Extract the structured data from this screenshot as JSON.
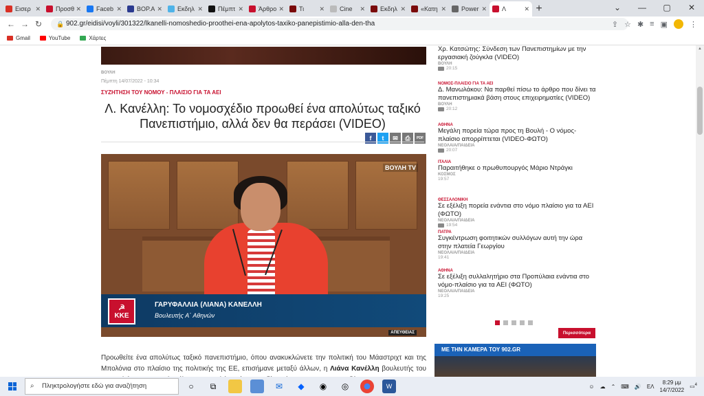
{
  "browser": {
    "tabs": [
      {
        "label": "Εισερ",
        "color": "#d93025",
        "active": false
      },
      {
        "label": "Προσθ",
        "color": "#c8102e",
        "active": false
      },
      {
        "label": "Faceb",
        "color": "#1877f2",
        "active": false
      },
      {
        "label": "BOP.A",
        "color": "#2b3a8f",
        "active": false
      },
      {
        "label": "Εκδηλ",
        "color": "#4fb3e8",
        "active": false
      },
      {
        "label": "Πέμπτ",
        "color": "#111111",
        "active": false
      },
      {
        "label": "Άρθρο",
        "color": "#c8102e",
        "active": false
      },
      {
        "label": "Τι",
        "color": "#7a0a0a",
        "active": false
      },
      {
        "label": "Cine",
        "color": "#bbbbbb",
        "active": false
      },
      {
        "label": "Εκδηλ",
        "color": "#7a0a0a",
        "active": false
      },
      {
        "label": "«Κατη",
        "color": "#7a0a0a",
        "active": false
      },
      {
        "label": "Power",
        "color": "#666666",
        "active": false
      },
      {
        "label": "Λ",
        "color": "#c8102e",
        "active": true
      }
    ],
    "new_tab": "+",
    "url": "902.gr/eidisi/voyli/301322/lkanelli-nomoshedio-proothei-ena-apolytos-taxiko-panepistimio-alla-den-tha",
    "bookmarks": [
      {
        "label": "Gmail",
        "color": "#d93025"
      },
      {
        "label": "YouTube",
        "color": "#ff0000"
      },
      {
        "label": "Χάρτες",
        "color": "#34a853"
      }
    ]
  },
  "article": {
    "source": "ΒΟΥΛΗ",
    "date": "Πέμπτη 14/07/2022 - 10:34",
    "category": "ΣΥΖΗΤΗΣΗ ΤΟΥ ΝΟΜΟΥ - ΠΛΑΙΣΙΟ ΓΙΑ ΤΑ ΑΕΙ",
    "title": "Λ. Κανέλλη: Το νομοσχέδιο προωθεί ένα απολύτως ταξικό Πανεπιστήμιο, αλλά δεν θα περάσει (VIDEO)",
    "share": {
      "facebook": "f",
      "twitter": "t",
      "email": "✉",
      "print": "⎙",
      "pdf": "PDF"
    },
    "video": {
      "channel_tag": "ΒΟΥΛΗ TV",
      "party_logo": "KKE",
      "speaker_name": "ΓΑΡΥΦΑΛΛΙΑ (ΛΙΑΝΑ) ΚΑΝΕΛΛΗ",
      "speaker_role": "Βουλευτής Α΄ Αθηνών",
      "live_tag": "ΑΠΕΥΘΕΙΑΣ"
    },
    "body_p1": "Προωθείτε ένα απολύτως ταξικό πανεπιστήμιο, όπου ανακυκλώνετε την πολιτική του Μάαστριχτ και της Μπολόνια στο πλαίσιο της πολιτικής της ΕΕ, επισήμανε μεταξύ άλλων, η ",
    "body_bold": "Λιάνα Κανέλλη",
    "body_p2": " βουλευτής του ΚΚΕ μιλώντας  στην Ολομέλεια της Βουλής επί του σχεδίου νόμου για τα ΑΕΙ, η συζήτηση του"
  },
  "sidebar": {
    "news": [
      {
        "section": "",
        "headline": "Χρ. Κατσώτης: Σύνδεση των Πανεπιστημίων με την εργασιακή ζούγκλα (VIDEO)",
        "sub": "ΒΟΥΛΗ",
        "time": "20:15",
        "media": "video"
      },
      {
        "section": "ΝΟΜΟΣ-ΠΛΑΙΣΙΟ ΓΙΑ ΤΑ ΑΕΙ",
        "headline": "Δ. Μανωλάκου: Να παρθεί πίσω το άρθρο που δίνει τα πανεπιστημιακά βάση στους επιχειρηματίες (VIDEO)",
        "sub": "ΒΟΥΛΗ",
        "time": "20:12",
        "media": "video"
      },
      {
        "section": "ΑΘΗΝΑ",
        "headline": "Μεγάλη πορεία τώρα προς τη Βουλή - Ο νόμος-πλαίσιο απορρίπτεται (VIDEO-ΦΩΤΟ)",
        "sub": "ΝΕΟΛΑΙΑ/ΠΑΙΔΕΙΑ",
        "time": "20:07",
        "media": "video"
      },
      {
        "section": "ΙΤΑΛΙΑ",
        "headline": "Παραιτήθηκε ο πρωθυπουργός Μάριο Ντράγκι",
        "sub": "ΚΟΣΜΟΣ",
        "time": "19:57",
        "media": ""
      },
      {
        "section": "ΘΕΣΣΑΛΟΝΙΚΗ",
        "headline": "Σε εξέλιξη πορεία ενάντια στο νόμο πλαίσιο για τα ΑΕΙ (ΦΩΤΟ)",
        "sub": "ΝΕΟΛΑΙΑ/ΠΑΙΔΕΙΑ",
        "time": "19:54",
        "media": "photo"
      },
      {
        "section": "ΠΑΤΡΑ",
        "headline": "Συγκέντρωση φοιτητικών συλλόγων αυτή την ώρα στην πλατεία Γεωργίου",
        "sub": "ΝΕΟΛΑΙΑ/ΠΑΙΔΕΙΑ",
        "time": "19:41",
        "media": ""
      },
      {
        "section": "ΑΘΗΝΑ",
        "headline": "Σε εξέλιξη συλλαλητήριο στα Προπύλαια ενάντια στο νόμο-πλαίσιο για τα ΑΕΙ (ΦΩΤΟ)",
        "sub": "ΝΕΟΛΑΙΑ/ΠΑΙΔΕΙΑ",
        "time": "19:25",
        "media": ""
      }
    ],
    "more_button": "Περισσότερα",
    "camera_header": "ΜΕ ΤΗΝ ΚΑΜΕΡΑ ΤΟΥ 902.GR"
  },
  "taskbar": {
    "search_placeholder": "Πληκτρολογήστε εδώ για αναζήτηση",
    "language": "ΕΛ",
    "time": "8:29 μμ",
    "date": "14/7/2022",
    "notifications": "4"
  },
  "colors": {
    "accent": "#c8102e",
    "link_blue": "#1a62b8"
  }
}
